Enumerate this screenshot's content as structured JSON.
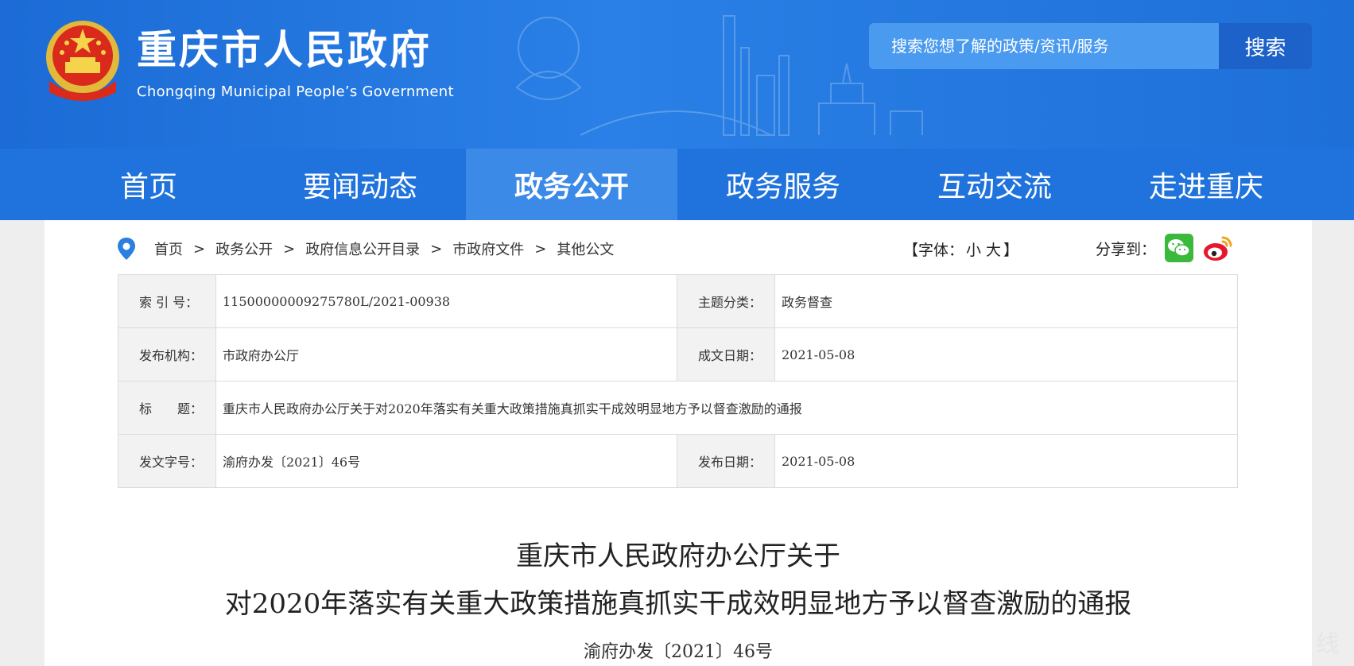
{
  "header": {
    "title": "重庆市人民政府",
    "subtitle": "Chongqing Municipal People’s Government",
    "search_placeholder": "搜索您想了解的政策/资讯/服务",
    "search_button": "搜索"
  },
  "nav": {
    "items": [
      {
        "label": "首页"
      },
      {
        "label": "要闻动态"
      },
      {
        "label": "政务公开",
        "active": true
      },
      {
        "label": "政务服务"
      },
      {
        "label": "互动交流"
      },
      {
        "label": "走进重庆"
      }
    ]
  },
  "breadcrumb": {
    "items": [
      "首页",
      "政务公开",
      "政府信息公开目录",
      "市政府文件",
      "其他公文"
    ],
    "separator": ">"
  },
  "font_size": {
    "open": "【字体：",
    "small": "小",
    "large": "大",
    "close": "】"
  },
  "share": {
    "label": "分享到："
  },
  "meta": {
    "index_label": "索 引 号：",
    "index_value": "11500000009275780L/2021-00938",
    "topic_label": "主题分类：",
    "topic_value": "政务督查",
    "publisher_label": "发布机构：",
    "publisher_value": "市政府办公厅",
    "written_label": "成文日期：",
    "written_value": "2021-05-08",
    "title_label": "标　　题：",
    "title_value": "重庆市人民政府办公厅关于对2020年落实有关重大政策措施真抓实干成效明显地方予以督查激励的通报",
    "docnum_label": "发文字号：",
    "docnum_value": "渝府办发〔2021〕46号",
    "publish_label": "发布日期：",
    "publish_value": "2021-05-08"
  },
  "document": {
    "title_line1": "重庆市人民政府办公厅关于",
    "title_line2": "对2020年落实有关重大政策措施真抓实干成效明显地方予以督查激励的通报",
    "number": "渝府办发〔2021〕46号"
  },
  "side_float": "线",
  "colors": {
    "header_blue": "#2a80e6",
    "nav_blue": "#2073dc",
    "nav_active": "#3b8ae8",
    "search_button": "#1d62c9"
  }
}
